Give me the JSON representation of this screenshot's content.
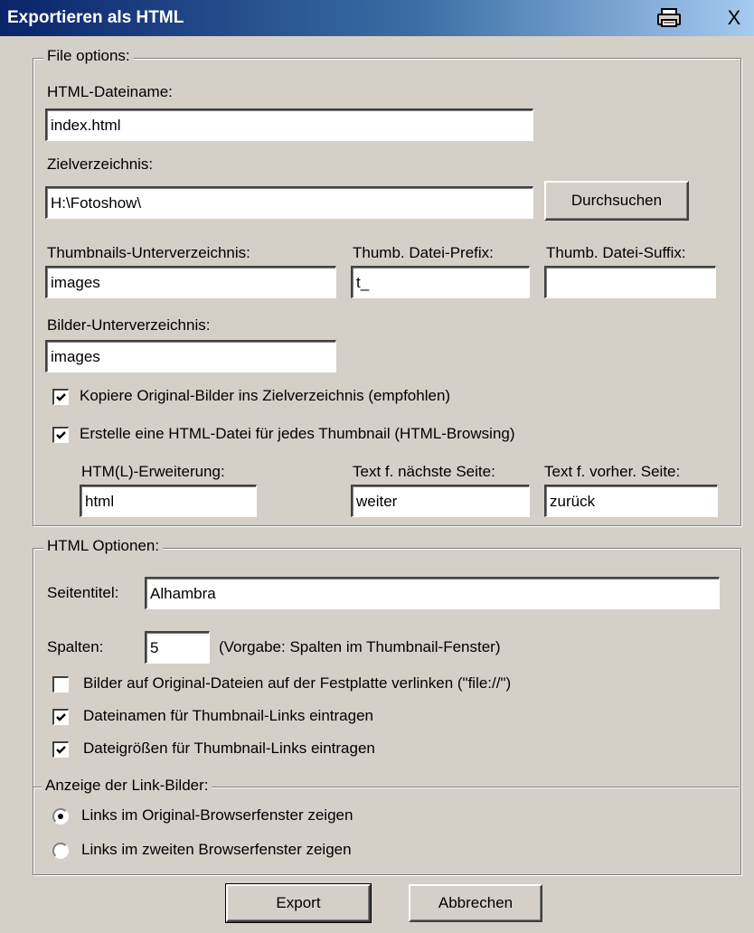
{
  "window": {
    "title": "Exportieren als HTML",
    "controls": [
      "print-icon",
      "close-icon"
    ],
    "close_glyph": "X"
  },
  "file_options": {
    "legend": "File options:",
    "html_filename_label": "HTML-Dateiname:",
    "html_filename_value": "index.html",
    "target_dir_label": "Zielverzeichnis:",
    "target_dir_value": "H:\\Fotoshow\\",
    "browse_button": "Durchsuchen",
    "thumb_subdir_label": "Thumbnails-Unterverzeichnis:",
    "thumb_subdir_value": "images",
    "thumb_prefix_label": "Thumb. Datei-Prefix:",
    "thumb_prefix_value": "t_",
    "thumb_suffix_label": "Thumb. Datei-Suffix:",
    "thumb_suffix_value": "",
    "image_subdir_label": "Bilder-Unterverzeichnis:",
    "image_subdir_value": "images",
    "copy_originals": {
      "label": "Kopiere Original-Bilder ins Zielverzeichnis (empfohlen)",
      "checked": true
    },
    "html_per_thumb": {
      "label": "Erstelle eine HTML-Datei für jedes Thumbnail (HTML-Browsing)",
      "checked": true
    },
    "extension_label": "HTM(L)-Erweiterung:",
    "extension_value": "html",
    "next_text_label": "Text f. nächste Seite:",
    "next_text_value": "weiter",
    "prev_text_label": "Text f. vorher. Seite:",
    "prev_text_value": "zurück"
  },
  "html_options": {
    "legend": "HTML Optionen:",
    "page_title_label": "Seitentitel:",
    "page_title_value": "Alhambra",
    "columns_label": "Spalten:",
    "columns_value": "5",
    "columns_hint": "(Vorgabe: Spalten im Thumbnail-Fenster)",
    "link_to_files": {
      "label": "Bilder auf Original-Dateien auf der Festplatte verlinken (\"file://\")",
      "checked": false
    },
    "filenames_for_links": {
      "label": "Dateinamen für Thumbnail-Links eintragen",
      "checked": true
    },
    "filesizes_for_links": {
      "label": "Dateigrößen für Thumbnail-Links eintragen",
      "checked": true
    },
    "link_display_legend": "Anzeige der Link-Bilder:",
    "radio_same_window": {
      "label": "Links im Original-Browserfenster zeigen",
      "selected": true
    },
    "radio_second_window": {
      "label": "Links im zweiten Browserfenster zeigen",
      "selected": false
    }
  },
  "footer": {
    "export_button": "Export",
    "cancel_button": "Abbrechen"
  }
}
